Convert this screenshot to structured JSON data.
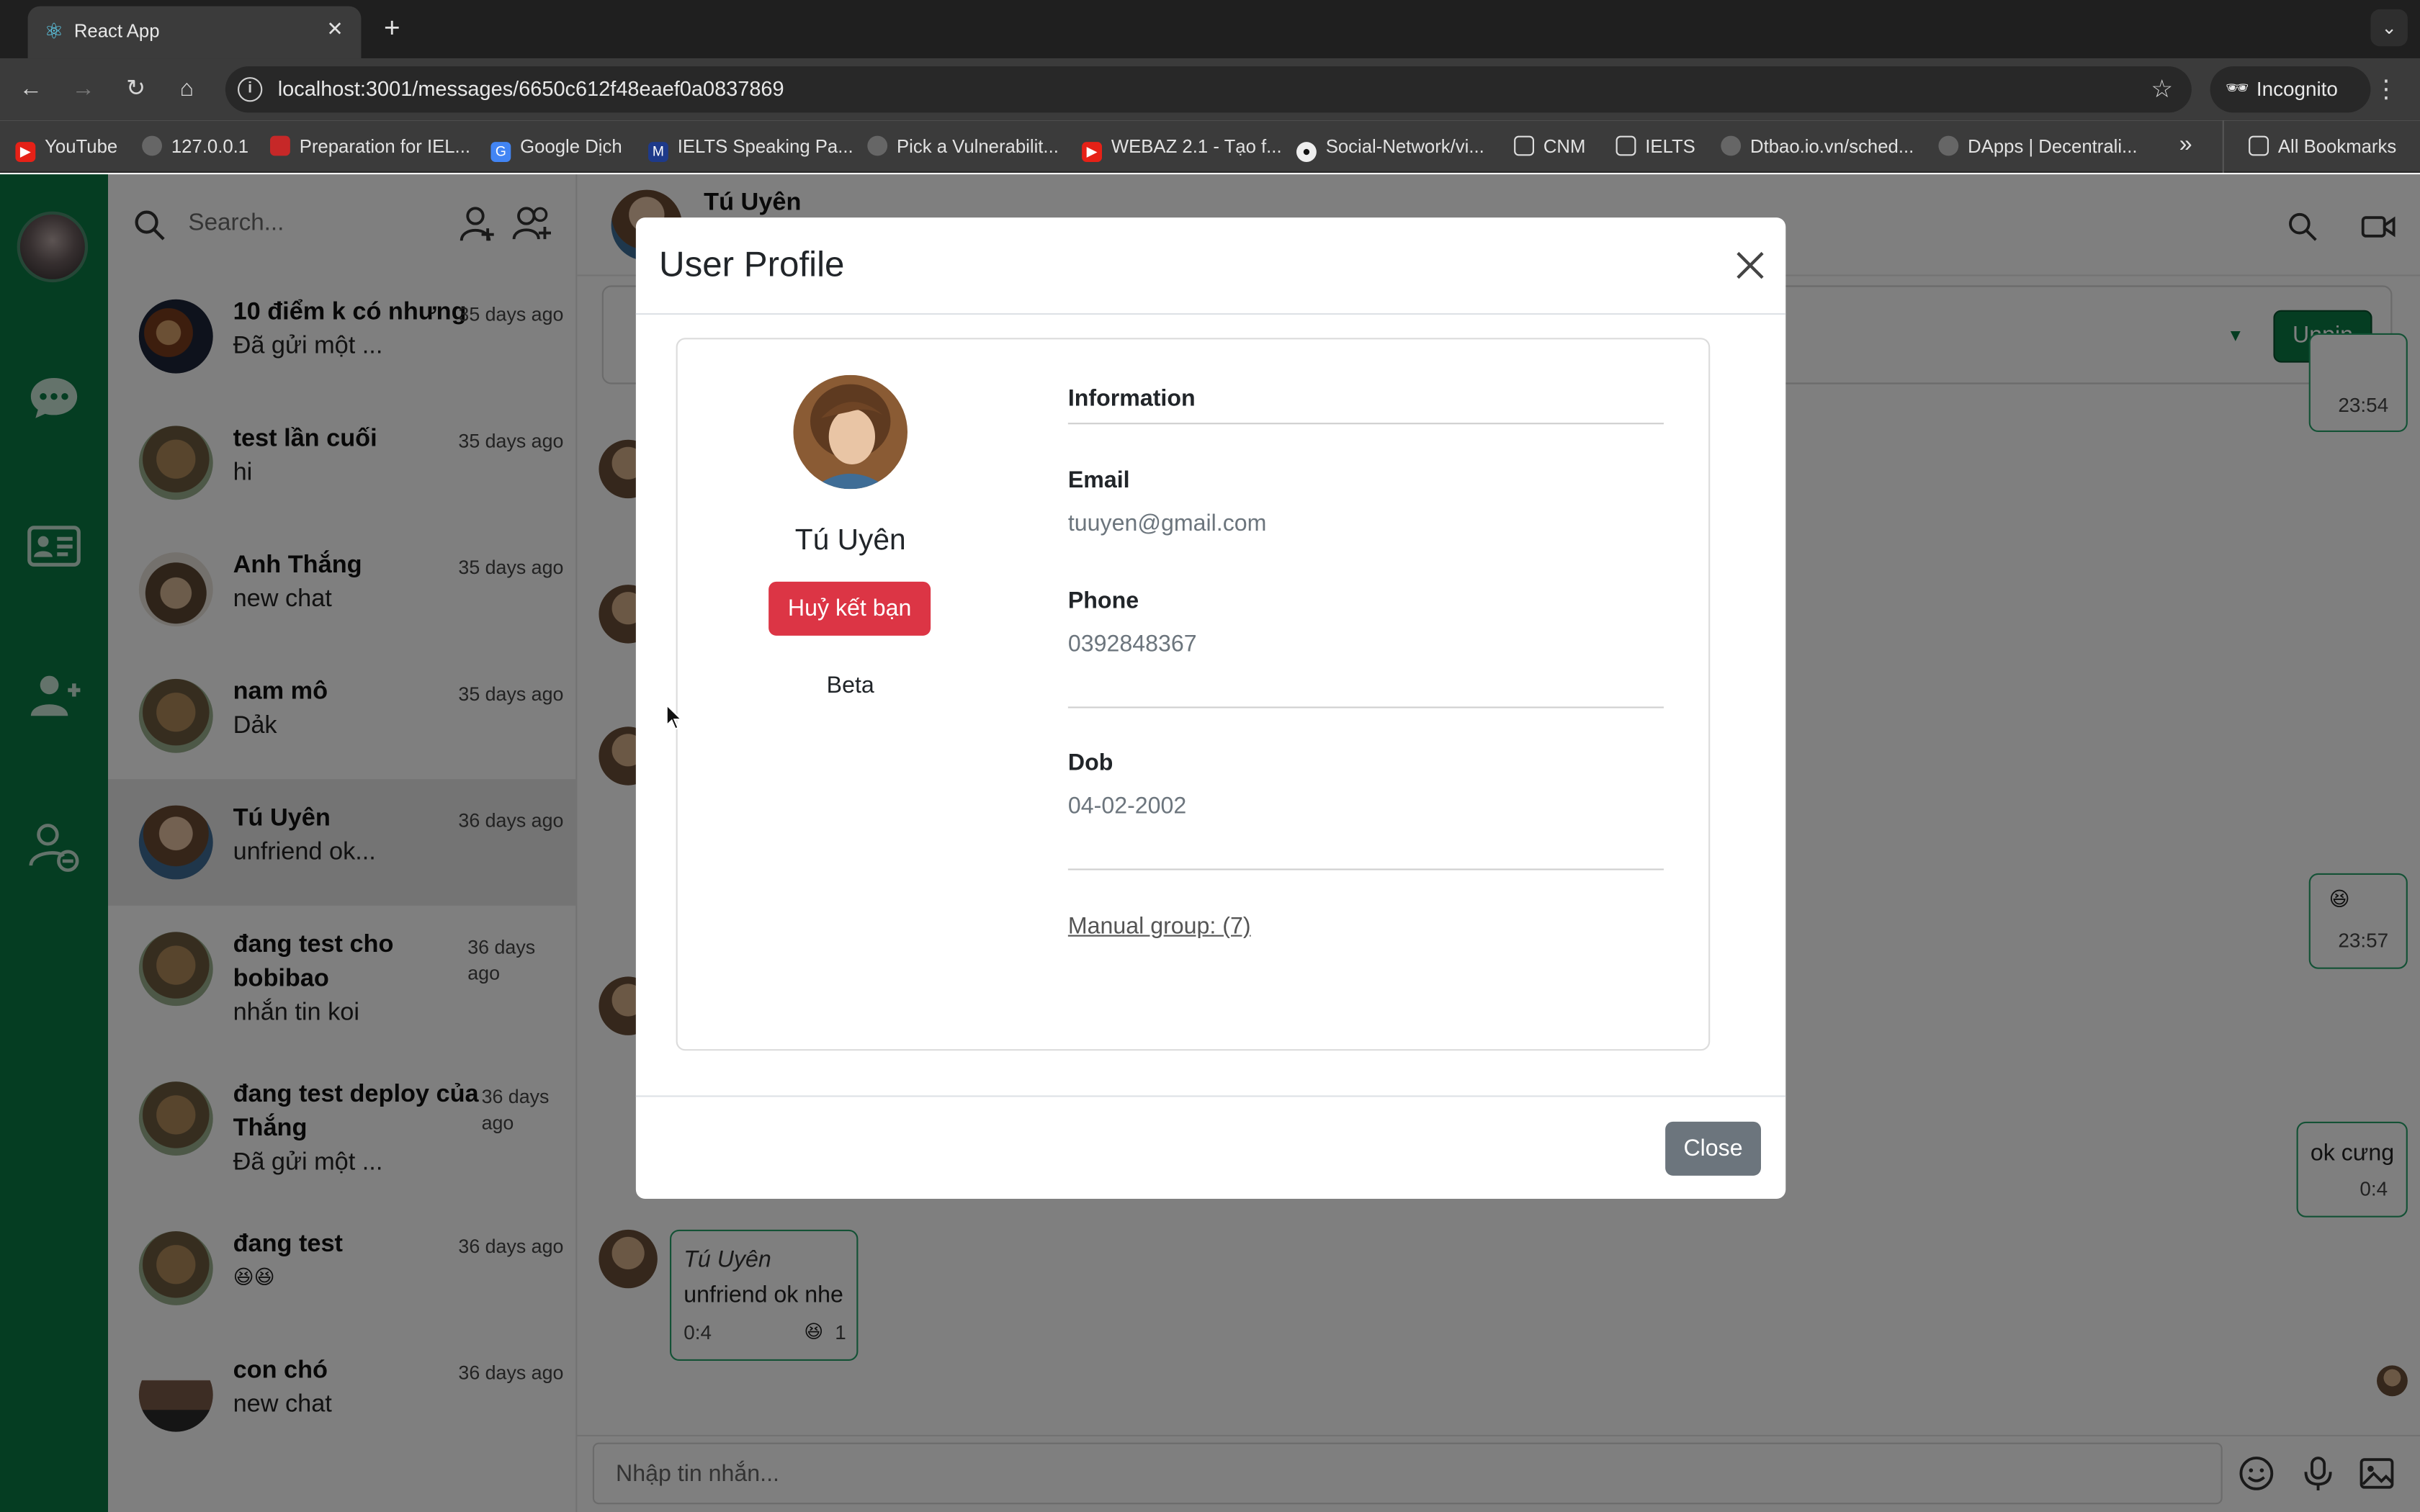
{
  "browser": {
    "tab_title": "React App",
    "url": "localhost:3001/messages/6650c612f48eaef0a0837869",
    "incognito_label": "Incognito",
    "bookmarks": [
      "YouTube",
      "127.0.0.1",
      "Preparation for IEL...",
      "Google Dịch",
      "IELTS Speaking Pa...",
      "Pick a Vulnerabilit...",
      "WEBAZ 2.1 - Tạo f...",
      "Social-Network/vi...",
      "CNM",
      "IELTS",
      "Dtbao.io.vn/sched...",
      "DApps | Decentrali..."
    ],
    "more_bookmarks": "»",
    "all_bookmarks": "All Bookmarks"
  },
  "sidebar": {
    "search_placeholder": "Search..."
  },
  "conversations": [
    {
      "name": "10 điểm k có nhưng",
      "preview": "Đã gửi một ...",
      "time": "35 days ago"
    },
    {
      "name": "test lần cuối",
      "preview": "hi",
      "time": "35 days ago"
    },
    {
      "name": "Anh Thắng",
      "preview": "new chat",
      "time": "35 days ago"
    },
    {
      "name": "nam mô",
      "preview": "Dảk",
      "time": "35 days ago"
    },
    {
      "name": "Tú Uyên",
      "preview": "unfriend ok...",
      "time": "36 days ago"
    },
    {
      "name_line1": "đang test cho",
      "name_line2": "bobibao",
      "preview": "nhắn tin koi",
      "time_line1": "36 days",
      "time_line2": "ago"
    },
    {
      "name_line1": "đang test deploy của",
      "name_line2": "Thắng",
      "preview": "Đã gửi một ...",
      "time_line1": "36 days",
      "time_line2": "ago"
    },
    {
      "name": "đang test",
      "preview": "😆😆",
      "time": "36 days ago"
    },
    {
      "name": "con chó",
      "preview": "new chat",
      "time": "36 days ago"
    }
  ],
  "chat": {
    "header_name": "Tú Uyên",
    "unpin_label": "Unpin",
    "messages": [
      {
        "time": "23:54"
      },
      {
        "emoji": "😆",
        "time": "23:57"
      },
      {
        "text": "ok cưng",
        "time": "0:4"
      },
      {
        "sender": "Tú Uyên",
        "text": "unfriend ok nhe",
        "time": "0:4",
        "reaction": "😆",
        "reaction_count": "1"
      }
    ],
    "composer_placeholder": "Nhập tin nhắn..."
  },
  "modal": {
    "title": "User Profile",
    "name": "Tú Uyên",
    "unfriend_label": "Huỷ kết bạn",
    "bio": "Beta",
    "info_heading": "Information",
    "email_label": "Email",
    "email": "tuuyen@gmail.com",
    "phone_label": "Phone",
    "phone": "0392848367",
    "dob_label": "Dob",
    "dob": "04-02-2002",
    "group_link": "Manual group: (7)",
    "close_label": "Close"
  },
  "colors": {
    "rail": "#0a7a45",
    "accent_green": "#27a36a",
    "danger": "#dc3545",
    "secondary": "#6c757d"
  }
}
